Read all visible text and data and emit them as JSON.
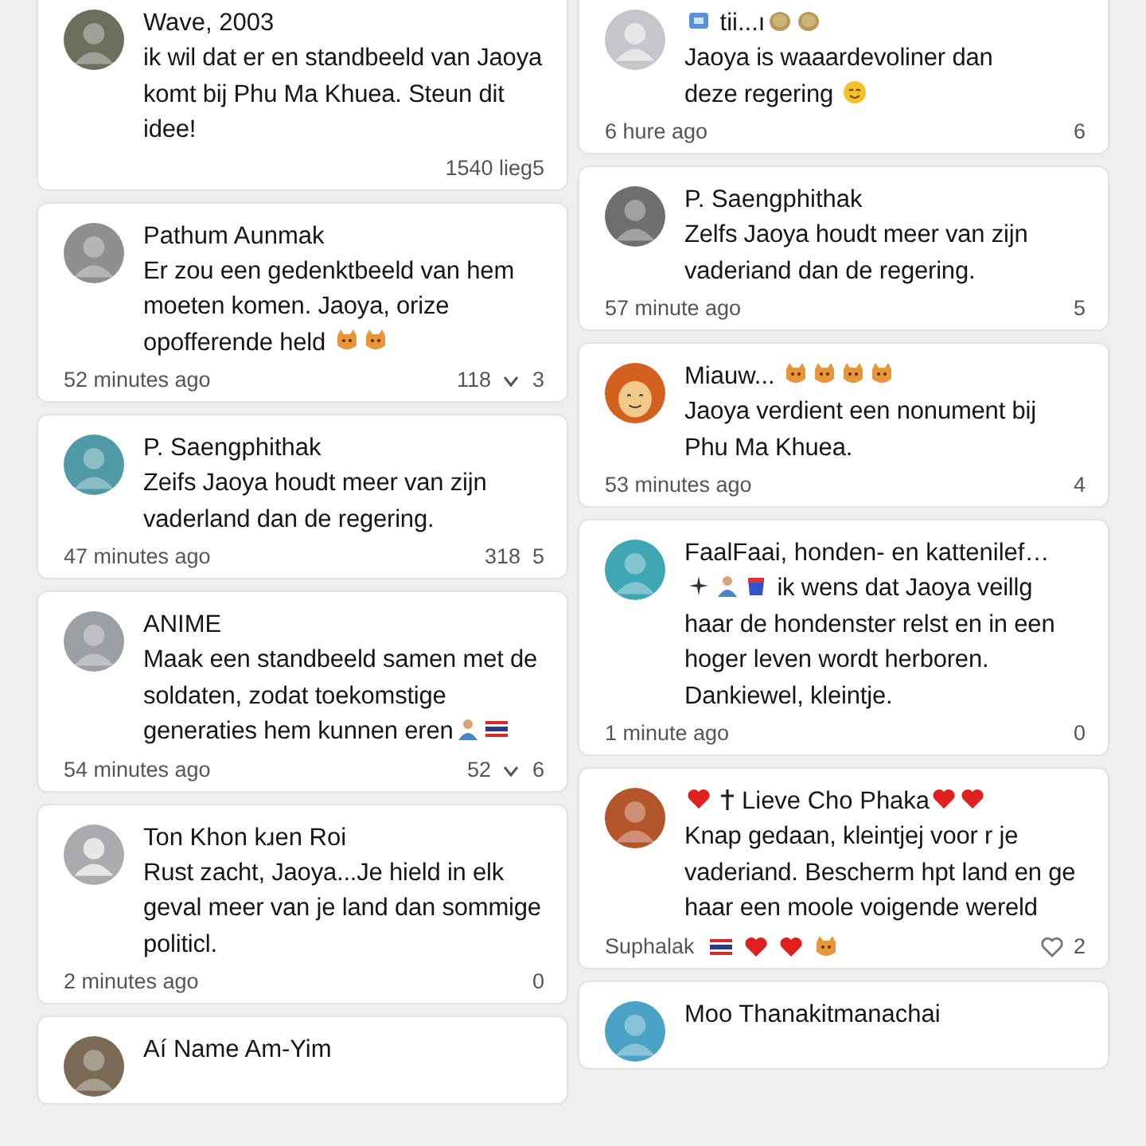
{
  "columns": [
    {
      "cards": [
        {
          "avatar": {
            "kind": "photo",
            "color": "#6b6f5c"
          },
          "name": [
            "Wave, 2003"
          ],
          "body": [
            "ik wil dat er en standbeeld van Jaoya komt bij Phu Ma Khuea. Steun dit idee!"
          ],
          "stats": [
            "1540 lieg5"
          ]
        },
        {
          "avatar": {
            "kind": "photo",
            "color": "#8d8f90"
          },
          "name": [
            "Pathum Aunmak"
          ],
          "body": [
            "Er zou een gedenktbeeld van hem moeten komen. Jaoya, orize",
            "opofferende held ",
            {
              "kind": "cat"
            },
            {
              "kind": "cat"
            }
          ],
          "time": [
            "52 minutes ago"
          ],
          "stats": [
            "118",
            {
              "kind": "chevron"
            },
            "3"
          ]
        },
        {
          "avatar": {
            "kind": "photo",
            "color": "#4f9aa6"
          },
          "name": [
            "P. Saengphithak"
          ],
          "body": [
            "Zeifs Jaoya houdt meer van zijn vaderland dan de regering."
          ],
          "time": [
            "47 minutes ago"
          ],
          "stats": [
            "318  5"
          ]
        },
        {
          "avatar": {
            "kind": "photo",
            "color": "#9c9fa3"
          },
          "name": [
            "ANIME"
          ],
          "body": [
            "Maak een standbeeld samen met de soldaten, zodat toekomstige",
            "generaties hem kunnen eren",
            {
              "kind": "person"
            },
            {
              "kind": "flag"
            }
          ],
          "time": [
            "54 minutes ago"
          ],
          "stats": [
            "52",
            {
              "kind": "chevron"
            },
            "6"
          ]
        },
        {
          "avatar": {
            "kind": "default",
            "color": "#a9abae"
          },
          "name": [
            "Ton Khon kɹen Roi"
          ],
          "body": [
            "Rust zacht, Jaoya...Je hield in elk geval meer van je land dan sommige politicl."
          ],
          "time": [
            "2 minutes ago"
          ],
          "stats": [
            "0"
          ]
        },
        {
          "avatar": {
            "kind": "photo",
            "color": "#7a6a55"
          },
          "name": [
            "Aí Name Am-Yim"
          ]
        }
      ]
    },
    {
      "cards": [
        {
          "avatar": {
            "kind": "default",
            "color": "#c4c6c9"
          },
          "name": [
            {
              "kind": "badge"
            },
            " tii...ı",
            {
              "kind": "blob"
            },
            {
              "kind": "blob"
            }
          ],
          "body": [
            "Jaoya is waaardevoliner dan",
            "deze regering ",
            {
              "kind": "smiley"
            }
          ],
          "time": [
            "6 hure ago"
          ],
          "stats": [
            "6"
          ]
        },
        {
          "avatar": {
            "kind": "photo",
            "color": "#6d6e70"
          },
          "name": [
            "P. Saengphithak"
          ],
          "body": [
            "Zelfs Jaoya houdt meer van zijn vaderiand dan de regering."
          ],
          "time": [
            "57 minute ago"
          ],
          "stats": [
            "5"
          ]
        },
        {
          "avatar": {
            "kind": "cartoon",
            "color": "#d4601f"
          },
          "name": [
            "Miauw... ",
            {
              "kind": "cat"
            },
            {
              "kind": "cat"
            },
            {
              "kind": "cat"
            },
            {
              "kind": "cat"
            }
          ],
          "body": [
            "Jaoya verdient een nonument bij Phu Ma Khuea."
          ],
          "time": [
            "53 minutes ago"
          ],
          "stats": [
            "4"
          ]
        },
        {
          "avatar": {
            "kind": "photo",
            "color": "#3fa6b4"
          },
          "name": [
            "FaalFaai, honden- en kattenilef…"
          ],
          "body": [
            {
              "kind": "sparkle"
            },
            {
              "kind": "person"
            },
            {
              "kind": "cup"
            },
            " ik wens dat Jaoya veillg",
            "haar de hondenster relst en in een hoger leven wordt herboren. Dankiewel, kleintje."
          ],
          "time": [
            "1 minute ago"
          ],
          "stats": [
            "0"
          ]
        },
        {
          "avatar": {
            "kind": "photo",
            "color": "#b4542a"
          },
          "name": [
            {
              "kind": "heart"
            },
            {
              "kind": "cross"
            },
            "Lieve Cho Phaka",
            {
              "kind": "heart"
            },
            {
              "kind": "heart"
            }
          ],
          "body": [
            "Knap gedaan, kleintjej voor r je vaderiand. Bescherm hpt land en ge haar een moole voigende wereld"
          ],
          "time": [
            "Suphalak ",
            {
              "kind": "flag"
            },
            {
              "kind": "heart"
            },
            {
              "kind": "heart"
            },
            {
              "kind": "cat"
            }
          ],
          "stats": [
            {
              "kind": "heart-outline"
            },
            "2"
          ]
        },
        {
          "avatar": {
            "kind": "photo",
            "color": "#4aa3c4"
          },
          "name": [
            "Moo Thanakitmanachai"
          ]
        }
      ]
    }
  ]
}
